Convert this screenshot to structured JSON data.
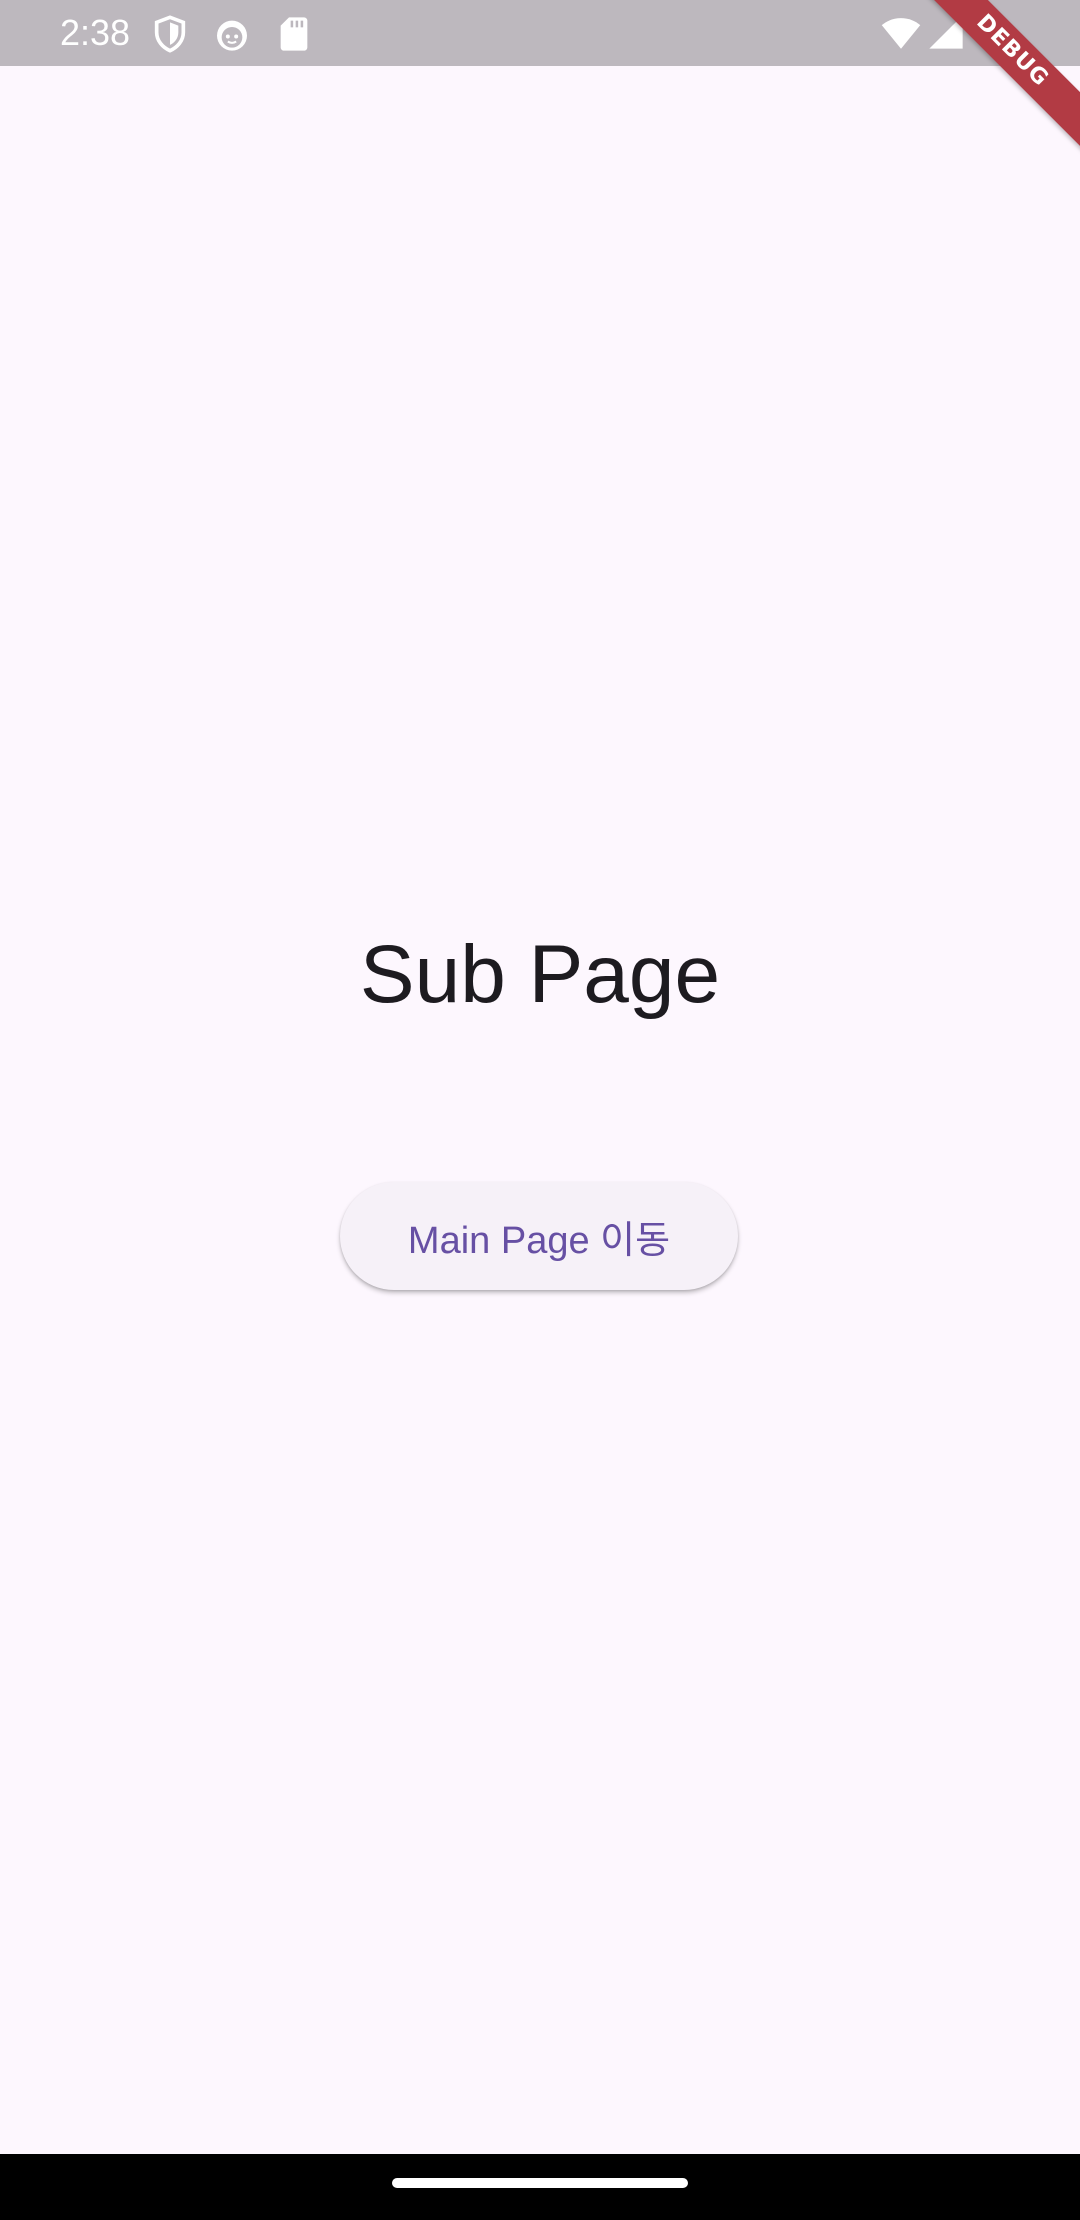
{
  "status_bar": {
    "time": "2:38",
    "icons_left": [
      "shield-icon",
      "android-face-icon",
      "sd-card-icon"
    ],
    "icons_right": [
      "wifi-icon",
      "signal-icon"
    ]
  },
  "debug_banner": {
    "label": "DEBUG"
  },
  "main": {
    "title": "Sub Page",
    "button_label": "Main Page 이동"
  },
  "colors": {
    "background": "#FDF7FE",
    "status_bar": "#BDB8BE",
    "button_text": "#6750A4",
    "button_bg": "#F6F1F8",
    "debug_banner": "#B23B44"
  }
}
